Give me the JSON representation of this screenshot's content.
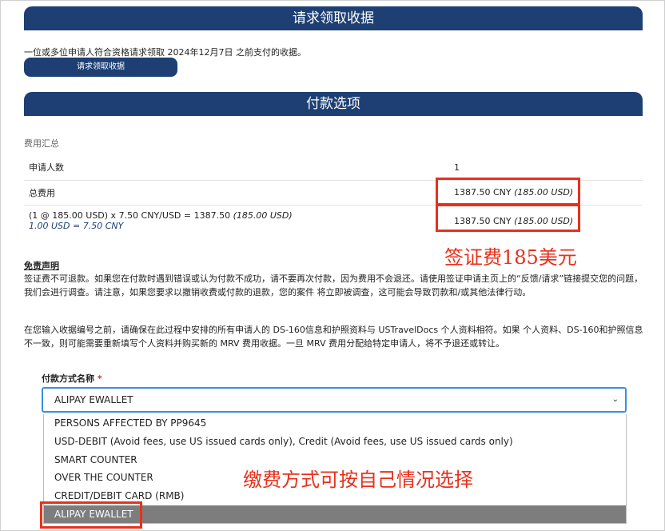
{
  "header1": "请求领取收据",
  "intro_text": "一位或多位申请人符合资格请求领取 2024年12月7日 之前支付的收据。",
  "claim_button_label": "请求领取收据",
  "header2": "付款选项",
  "fee_summary_label": "费用汇总",
  "fees": {
    "applicants_label": "申请人数",
    "applicants_value": "1",
    "total_label": "总费用",
    "total_value": "1387.50 CNY",
    "total_usd": "(185.00 USD)",
    "calc_text": "(1 @ 185.00 USD) x 7.50 CNY/USD = 1387.50",
    "calc_usd": "(185.00 USD)",
    "rate_text": "1.00 USD = 7.50 CNY",
    "calc_value": "1387.50 CNY",
    "calc_value_usd": "(185.00 USD)"
  },
  "annotation_visa_fee": "签证费185美元",
  "disclaimer_title": "免责声明",
  "disclaimer_text": "签证费不可退款。如果您在付款时遇到错误或认为付款不成功，请不要再次付款，因为费用不会退还。请使用签证申请主页上的“反馈/请求”链接提交您的问题，我们会进行调查。请注意，如果您要求以撤销收费或付款的退款，您的案件 将立即被调查，这可能会导致罚款和/或其他法律行动。",
  "notice_text": "在您输入收据编号之前，请确保在此过程中安排的所有申请人的 DS-160信息和护照资料与 USTravelDocs 个人资料相符。如果 个人资料、DS-160和护照信息不一致，则可能需要重新填写个人资料并购买新的 MRV 费用收据。一旦 MRV 费用分配给特定申请人，将不予退还或转让。",
  "payment_method_label": "付款方式名称",
  "required_mark": "*",
  "payment_method_selected": "ALIPAY EWALLET",
  "payment_options": [
    "PERSONS AFFECTED BY PP9645",
    "USD-DEBIT (Avoid fees, use US issued cards only), Credit (Avoid fees, use US issued cards only)",
    "SMART COUNTER",
    "OVER THE COUNTER",
    "CREDIT/DEBIT CARD (RMB)",
    "ALIPAY EWALLET"
  ],
  "annotation_payment": "缴费方式可按自己情况选择",
  "colors": {
    "header_bg": "#1d3f73",
    "annotation_red": "#e8301c",
    "focus_blue": "#3a8ee6",
    "selected_bg": "#7d7d7d"
  }
}
